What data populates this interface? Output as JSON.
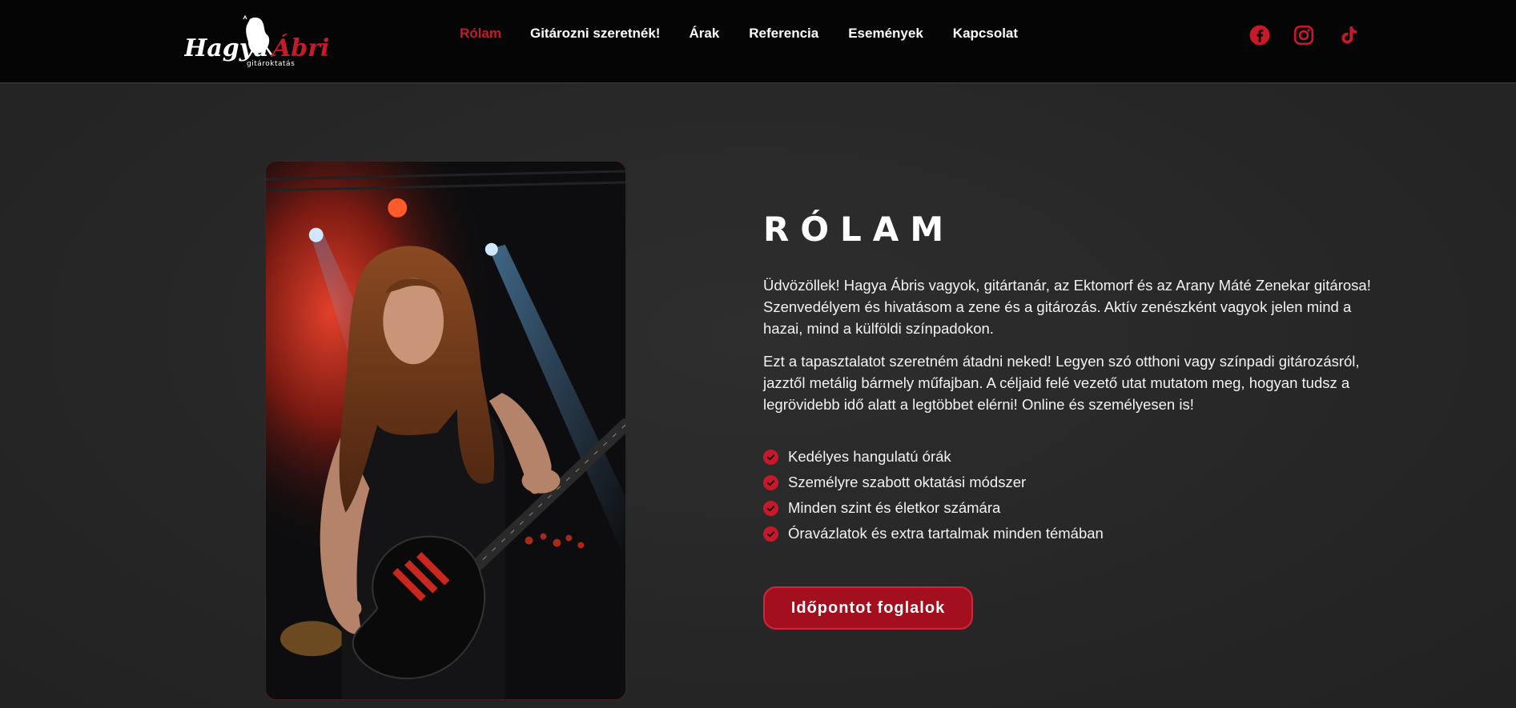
{
  "header": {
    "logo": {
      "name_left": "Hagya",
      "name_right": "Ábris",
      "tagline": "gitároktatás"
    },
    "nav": [
      {
        "label": "Rólam",
        "active": true
      },
      {
        "label": "Gitározni szeretnék!"
      },
      {
        "label": "Árak"
      },
      {
        "label": "Referencia"
      },
      {
        "label": "Események"
      },
      {
        "label": "Kapcsolat"
      }
    ],
    "social": [
      {
        "icon": "facebook-icon"
      },
      {
        "icon": "instagram-icon"
      },
      {
        "icon": "tiktok-icon"
      }
    ],
    "accent_color": "#c8192a"
  },
  "about": {
    "title": "RÓLAM",
    "paragraphs": [
      "Üdvözöllek! Hagya Ábris vagyok, gitártanár, az Ektomorf és az Arany Máté Zenekar gitárosa! Szenvedélyem és hivatásom a zene és a gitározás. Aktív zenészként vagyok jelen mind a hazai, mind a külföldi színpadokon.",
      "Ezt a tapasztalatot szeretném átadni neked! Legyen szó otthoni vagy színpadi gitározásról, jazztől metálig bármely műfajban. A céljaid felé vezető utat mutatom meg, hogyan tudsz a legrövidebb idő alatt a legtöbbet elérni! Online és személyesen is!"
    ],
    "features": [
      "Kedélyes hangulatú órák",
      "Személyre szabott oktatási módszer",
      "Minden szint és életkor számára",
      "Óravázlatok és extra tartalmak minden témában"
    ],
    "cta_label": "Időpontot foglalok"
  }
}
